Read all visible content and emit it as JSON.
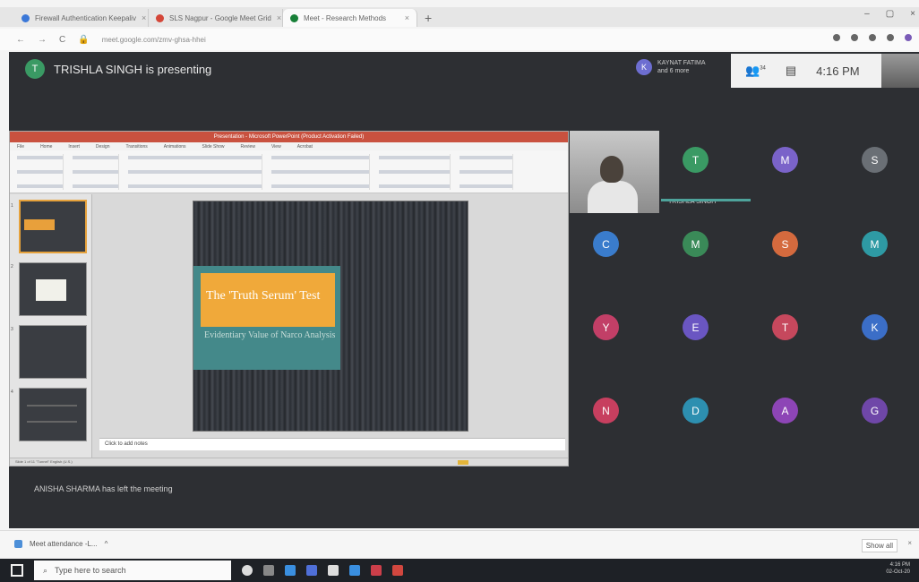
{
  "browser": {
    "tabs": [
      {
        "label": "Firewall Authentication Keepaliv",
        "fav_color": "#3b78d8"
      },
      {
        "label": "SLS Nagpur - Google Meet Grid",
        "fav_color": "#d44638"
      },
      {
        "label": "Meet - Research Methods",
        "fav_color": "#188038"
      }
    ],
    "url": "meet.google.com/zmv-ghsa-hhei",
    "window_controls": [
      "–",
      "▢",
      "×"
    ]
  },
  "meet": {
    "presenter_avatar": "T",
    "presenter_text": "TRISHLA SINGH is presenting",
    "pinned_user": {
      "avatar": "K",
      "name": "KAYNAT FATIMA",
      "sub": "and 6 more"
    },
    "participants_count": "34",
    "time": "4:16 PM",
    "selfcam_label": "TRISHLA SINGH",
    "left_notice": "ANISHA SHARMA has left the meeting"
  },
  "shared_screen": {
    "title": "Presentation - Microsoft PowerPoint (Product Activation Failed)",
    "ribbon_tabs": [
      "File",
      "Home",
      "Insert",
      "Design",
      "Transitions",
      "Animations",
      "Slide Show",
      "Review",
      "View",
      "Acrobat"
    ],
    "thumb_numbers": [
      "1",
      "2",
      "3",
      "4"
    ],
    "slide": {
      "title": "The 'Truth Serum' Test",
      "subtitle": "Evidentiary Value of Narco Analysis"
    },
    "notes": "Click to add notes",
    "status": "Slide 1 of 11   \"Tunnel\"   English (U.S.)"
  },
  "participants": [
    {
      "letter": "T",
      "color": "#3a9a64"
    },
    {
      "letter": "M",
      "color": "#7a63c9"
    },
    {
      "letter": "S",
      "color": "#6a6f75"
    },
    {
      "letter": "C",
      "color": "#3a7ccc"
    },
    {
      "letter": "M",
      "color": "#3a8a58"
    },
    {
      "letter": "S",
      "color": "#d46a3e"
    },
    {
      "letter": "M",
      "color": "#2e9aa4"
    },
    {
      "letter": "Y",
      "color": "#c23f67"
    },
    {
      "letter": "E",
      "color": "#6a56c2"
    },
    {
      "letter": "T",
      "color": "#c6485d"
    },
    {
      "letter": "K",
      "color": "#3b6ec7"
    },
    {
      "letter": "N",
      "color": "#c73f5f"
    },
    {
      "letter": "D",
      "color": "#2d8fb0"
    },
    {
      "letter": "A",
      "color": "#8d45b6"
    },
    {
      "letter": "G",
      "color": "#6f47a8"
    }
  ],
  "downloads": {
    "file": "Meet attendance -L...",
    "show_all": "Show all"
  },
  "taskbar": {
    "search_placeholder": "Type here to search",
    "clock": "4:16 PM",
    "date": "02-Oct-20"
  }
}
